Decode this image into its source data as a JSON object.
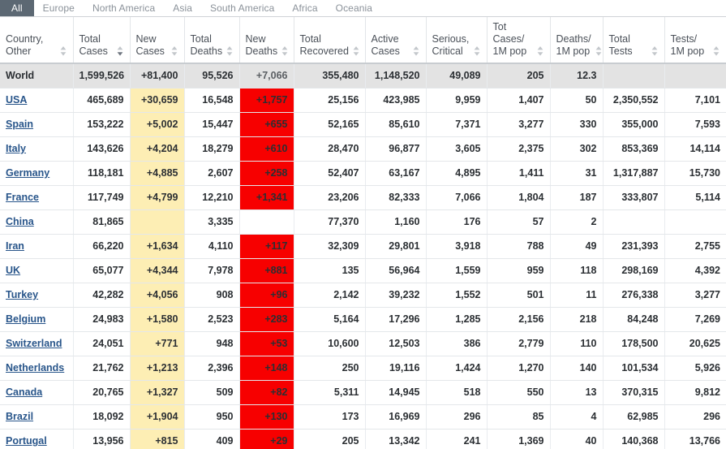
{
  "tabs": [
    {
      "label": "All",
      "active": true
    },
    {
      "label": "Europe",
      "active": false
    },
    {
      "label": "North America",
      "active": false
    },
    {
      "label": "Asia",
      "active": false
    },
    {
      "label": "South America",
      "active": false
    },
    {
      "label": "Africa",
      "active": false
    },
    {
      "label": "Oceania",
      "active": false
    }
  ],
  "colors": {
    "active_tab_bg": "#5c6873",
    "new_cases_highlight": "#fdeeb4",
    "new_deaths_highlight": "#f70000",
    "world_row_bg": "#e3e3e3",
    "link": "#28558a"
  },
  "table": {
    "columns": [
      {
        "label": "Country,\nOther",
        "sort": "both"
      },
      {
        "label": "Total\nCases",
        "sort": "desc-active"
      },
      {
        "label": "New\nCases",
        "sort": "both"
      },
      {
        "label": "Total\nDeaths",
        "sort": "both"
      },
      {
        "label": "New\nDeaths",
        "sort": "both"
      },
      {
        "label": "Total\nRecovered",
        "sort": "both"
      },
      {
        "label": "Active\nCases",
        "sort": "both"
      },
      {
        "label": "Serious,\nCritical",
        "sort": "both"
      },
      {
        "label": "Tot Cases/\n1M pop",
        "sort": "both"
      },
      {
        "label": "Deaths/\n1M pop",
        "sort": "both"
      },
      {
        "label": "Total\nTests",
        "sort": "both"
      },
      {
        "label": "Tests/\n1M pop",
        "sort": "both"
      }
    ],
    "world_row": {
      "country": "World",
      "total_cases": "1,599,526",
      "new_cases": "+81,400",
      "total_deaths": "95,526",
      "new_deaths": "+7,066",
      "total_recovered": "355,480",
      "active_cases": "1,148,520",
      "serious_critical": "49,089",
      "tot_cases_1m": "205",
      "deaths_1m": "12.3",
      "total_tests": "",
      "tests_1m": ""
    },
    "rows": [
      {
        "country": "USA",
        "total_cases": "465,689",
        "new_cases": "+30,659",
        "total_deaths": "16,548",
        "new_deaths": "+1,757",
        "total_recovered": "25,156",
        "active_cases": "423,985",
        "serious_critical": "9,959",
        "tot_cases_1m": "1,407",
        "deaths_1m": "50",
        "total_tests": "2,350,552",
        "tests_1m": "7,101"
      },
      {
        "country": "Spain",
        "total_cases": "153,222",
        "new_cases": "+5,002",
        "total_deaths": "15,447",
        "new_deaths": "+655",
        "total_recovered": "52,165",
        "active_cases": "85,610",
        "serious_critical": "7,371",
        "tot_cases_1m": "3,277",
        "deaths_1m": "330",
        "total_tests": "355,000",
        "tests_1m": "7,593"
      },
      {
        "country": "Italy",
        "total_cases": "143,626",
        "new_cases": "+4,204",
        "total_deaths": "18,279",
        "new_deaths": "+610",
        "total_recovered": "28,470",
        "active_cases": "96,877",
        "serious_critical": "3,605",
        "tot_cases_1m": "2,375",
        "deaths_1m": "302",
        "total_tests": "853,369",
        "tests_1m": "14,114"
      },
      {
        "country": "Germany",
        "total_cases": "118,181",
        "new_cases": "+4,885",
        "total_deaths": "2,607",
        "new_deaths": "+258",
        "total_recovered": "52,407",
        "active_cases": "63,167",
        "serious_critical": "4,895",
        "tot_cases_1m": "1,411",
        "deaths_1m": "31",
        "total_tests": "1,317,887",
        "tests_1m": "15,730"
      },
      {
        "country": "France",
        "total_cases": "117,749",
        "new_cases": "+4,799",
        "total_deaths": "12,210",
        "new_deaths": "+1,341",
        "total_recovered": "23,206",
        "active_cases": "82,333",
        "serious_critical": "7,066",
        "tot_cases_1m": "1,804",
        "deaths_1m": "187",
        "total_tests": "333,807",
        "tests_1m": "5,114"
      },
      {
        "country": "China",
        "total_cases": "81,865",
        "new_cases": "",
        "total_deaths": "3,335",
        "new_deaths": "",
        "total_recovered": "77,370",
        "active_cases": "1,160",
        "serious_critical": "176",
        "tot_cases_1m": "57",
        "deaths_1m": "2",
        "total_tests": "",
        "tests_1m": ""
      },
      {
        "country": "Iran",
        "total_cases": "66,220",
        "new_cases": "+1,634",
        "total_deaths": "4,110",
        "new_deaths": "+117",
        "total_recovered": "32,309",
        "active_cases": "29,801",
        "serious_critical": "3,918",
        "tot_cases_1m": "788",
        "deaths_1m": "49",
        "total_tests": "231,393",
        "tests_1m": "2,755"
      },
      {
        "country": "UK",
        "total_cases": "65,077",
        "new_cases": "+4,344",
        "total_deaths": "7,978",
        "new_deaths": "+881",
        "total_recovered": "135",
        "active_cases": "56,964",
        "serious_critical": "1,559",
        "tot_cases_1m": "959",
        "deaths_1m": "118",
        "total_tests": "298,169",
        "tests_1m": "4,392"
      },
      {
        "country": "Turkey",
        "total_cases": "42,282",
        "new_cases": "+4,056",
        "total_deaths": "908",
        "new_deaths": "+96",
        "total_recovered": "2,142",
        "active_cases": "39,232",
        "serious_critical": "1,552",
        "tot_cases_1m": "501",
        "deaths_1m": "11",
        "total_tests": "276,338",
        "tests_1m": "3,277"
      },
      {
        "country": "Belgium",
        "total_cases": "24,983",
        "new_cases": "+1,580",
        "total_deaths": "2,523",
        "new_deaths": "+283",
        "total_recovered": "5,164",
        "active_cases": "17,296",
        "serious_critical": "1,285",
        "tot_cases_1m": "2,156",
        "deaths_1m": "218",
        "total_tests": "84,248",
        "tests_1m": "7,269"
      },
      {
        "country": "Switzerland",
        "total_cases": "24,051",
        "new_cases": "+771",
        "total_deaths": "948",
        "new_deaths": "+53",
        "total_recovered": "10,600",
        "active_cases": "12,503",
        "serious_critical": "386",
        "tot_cases_1m": "2,779",
        "deaths_1m": "110",
        "total_tests": "178,500",
        "tests_1m": "20,625"
      },
      {
        "country": "Netherlands",
        "total_cases": "21,762",
        "new_cases": "+1,213",
        "total_deaths": "2,396",
        "new_deaths": "+148",
        "total_recovered": "250",
        "active_cases": "19,116",
        "serious_critical": "1,424",
        "tot_cases_1m": "1,270",
        "deaths_1m": "140",
        "total_tests": "101,534",
        "tests_1m": "5,926"
      },
      {
        "country": "Canada",
        "total_cases": "20,765",
        "new_cases": "+1,327",
        "total_deaths": "509",
        "new_deaths": "+82",
        "total_recovered": "5,311",
        "active_cases": "14,945",
        "serious_critical": "518",
        "tot_cases_1m": "550",
        "deaths_1m": "13",
        "total_tests": "370,315",
        "tests_1m": "9,812"
      },
      {
        "country": "Brazil",
        "total_cases": "18,092",
        "new_cases": "+1,904",
        "total_deaths": "950",
        "new_deaths": "+130",
        "total_recovered": "173",
        "active_cases": "16,969",
        "serious_critical": "296",
        "tot_cases_1m": "85",
        "deaths_1m": "4",
        "total_tests": "62,985",
        "tests_1m": "296"
      },
      {
        "country": "Portugal",
        "total_cases": "13,956",
        "new_cases": "+815",
        "total_deaths": "409",
        "new_deaths": "+29",
        "total_recovered": "205",
        "active_cases": "13,342",
        "serious_critical": "241",
        "tot_cases_1m": "1,369",
        "deaths_1m": "40",
        "total_tests": "140,368",
        "tests_1m": "13,766"
      }
    ]
  }
}
